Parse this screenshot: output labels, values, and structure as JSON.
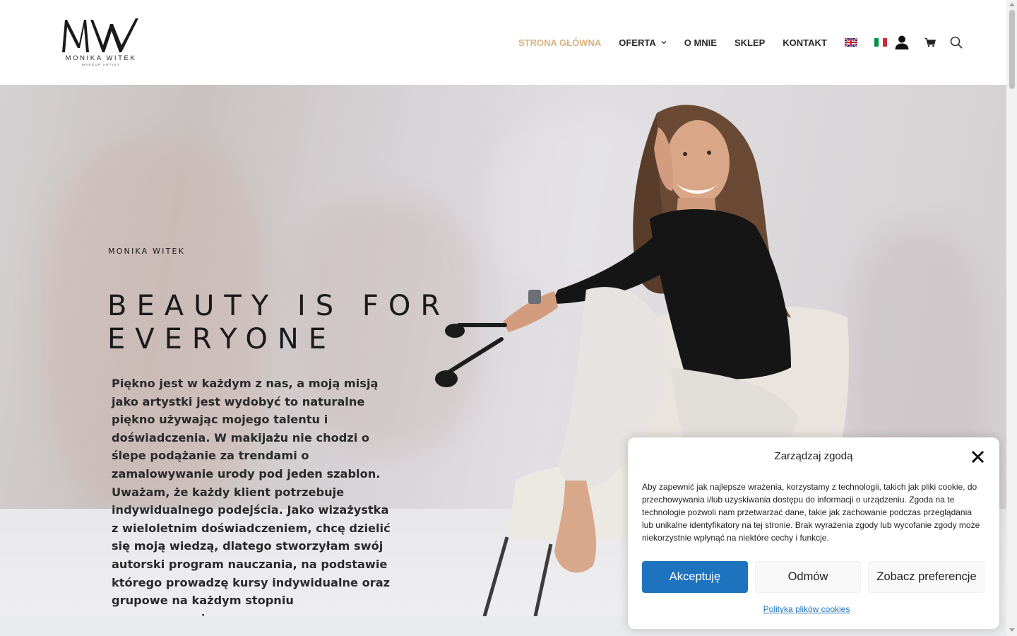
{
  "logo": {
    "name": "MONIKA WITEK",
    "sub": "MAKEUP ARTIST"
  },
  "nav": {
    "items": [
      {
        "label": "STRONA GŁÓWNA",
        "active": true
      },
      {
        "label": "OFERTA",
        "has_dropdown": true
      },
      {
        "label": "O MNIE"
      },
      {
        "label": "SKLEP"
      },
      {
        "label": "KONTAKT"
      }
    ],
    "languages": [
      "english-flag-icon",
      "italian-flag-icon"
    ],
    "active_color": "#d8b27f"
  },
  "header_icons": [
    "user-icon",
    "cart-icon",
    "search-icon"
  ],
  "hero": {
    "eyebrow": "MONIKA WITEK",
    "headline": "BEAUTY IS FOR EVERYONE",
    "intro": "Piękno jest w każdym z nas, a moją misją jako artystki jest wydobyć to naturalne piękno używając mojego talentu i doświadczenia. W makijażu nie chodzi o ślepe podążanie za trendami o zamalowywanie urody pod jeden szablon. Uważam, że każdy klient potrzebuje indywidualnego podejścia. Jako wizażystka z wieloletnim doświadczeniem, chcę dzielić się moją wiedzą, dlatego stworzyłam swój autorski program nauczania, na podstawie którego prowadzę kursy indywidualne oraz grupowe na każdym stopniu zaawansowania."
  },
  "cookie": {
    "title": "Zarządzaj zgodą",
    "text": "Aby zapewnić jak najlepsze wrażenia, korzystamy z technologii, takich jak pliki cookie, do przechowywania i/lub uzyskiwania dostępu do informacji o urządzeniu. Zgoda na te technologie pozwoli nam przetwarzać dane, takie jak zachowanie podczas przeglądania lub unikalne identyfikatory na tej stronie. Brak wyrażenia zgody lub wycofanie zgody może niekorzystnie wpłynąć na niektóre cechy i funkcje.",
    "accept": "Akceptuję",
    "deny": "Odmów",
    "preferences": "Zobacz preferencje",
    "policy_link": "Polityka plików cookies",
    "accent": "#1e73be"
  }
}
